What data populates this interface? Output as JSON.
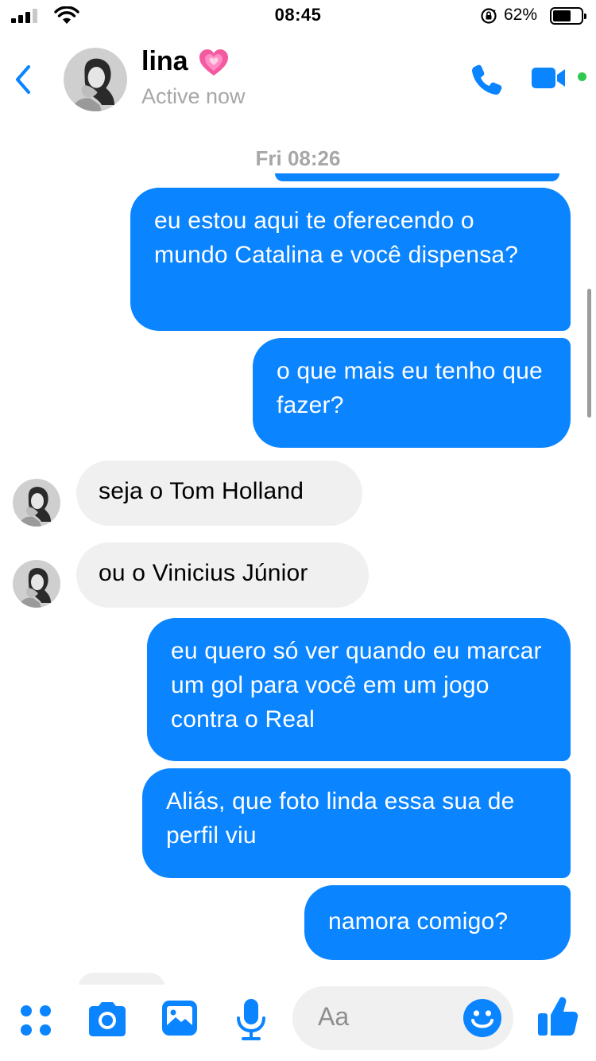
{
  "status_bar": {
    "time": "08:45",
    "battery_percent": "62%"
  },
  "header": {
    "contact_name": "lina",
    "status": "Active now"
  },
  "chat": {
    "timestamp": "Fri 08:26",
    "messages": [
      {
        "direction": "outgoing",
        "text": "eu estou aqui te oferecendo o mundo Catalina e você dispensa?"
      },
      {
        "direction": "outgoing",
        "text": "o que mais eu tenho que fazer?"
      },
      {
        "direction": "incoming",
        "text": "seja o Tom Holland"
      },
      {
        "direction": "incoming",
        "text": "ou o Vinicius Júnior"
      },
      {
        "direction": "outgoing",
        "text": "eu quero só ver quando eu marcar um gol para você em um jogo contra o Real"
      },
      {
        "direction": "outgoing",
        "text": "Aliás, que foto linda essa sua de perfil viu"
      },
      {
        "direction": "outgoing",
        "text": "namora comigo?"
      }
    ]
  },
  "composer": {
    "placeholder": "Aa"
  },
  "colors": {
    "accent": "#0a84ff",
    "incoming_bubble": "#f0f0f0",
    "muted_text": "#a7a7a7",
    "online": "#2ec94f"
  },
  "icons": [
    "signal-icon",
    "wifi-icon",
    "lock-rotation-icon",
    "battery-icon",
    "back-icon",
    "growing-heart-icon",
    "phone-icon",
    "video-icon",
    "menu-dots-icon",
    "camera-icon",
    "gallery-icon",
    "microphone-icon",
    "emoji-icon",
    "thumbs-up-icon"
  ]
}
